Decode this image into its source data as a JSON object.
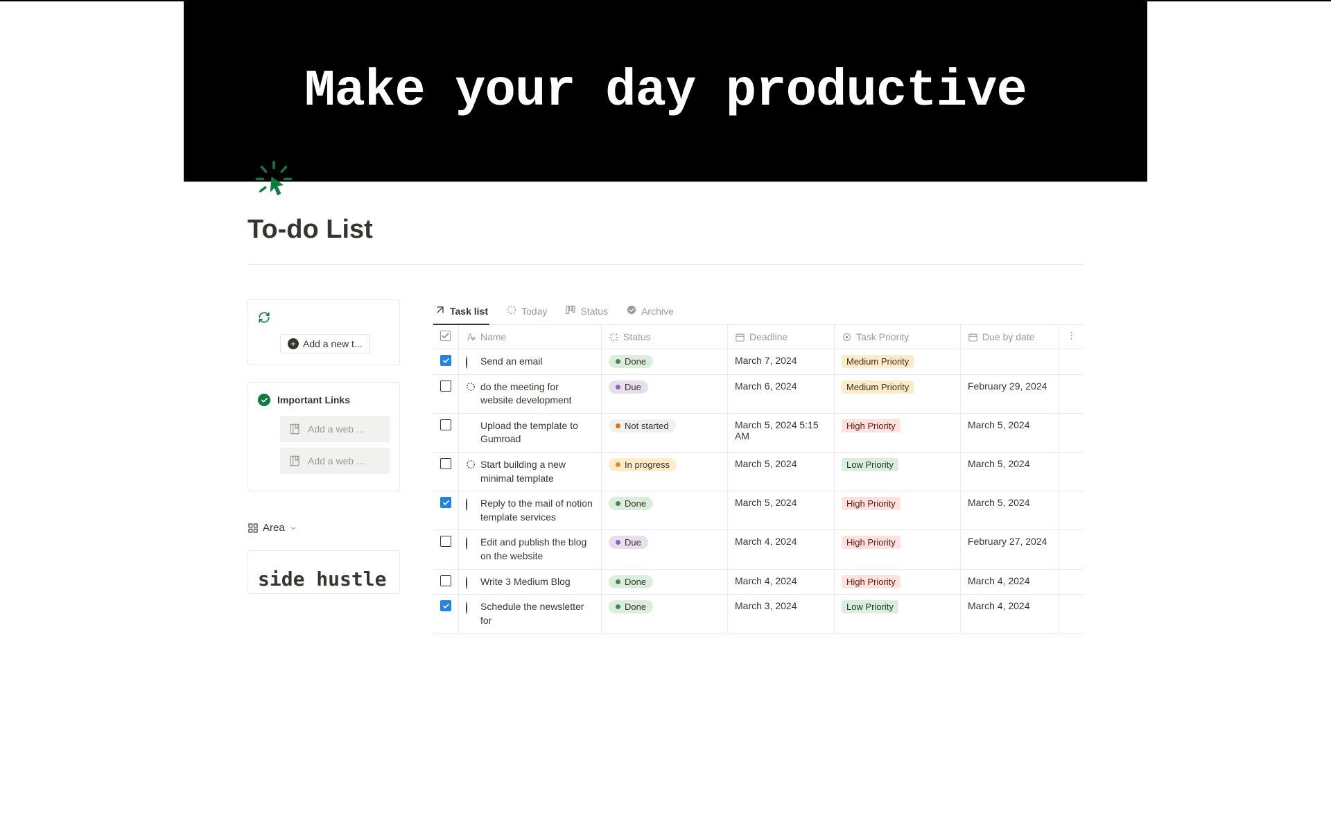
{
  "hero": {
    "title": "Make your day productive"
  },
  "page": {
    "title": "To-do List"
  },
  "sidebar": {
    "add_task_label": "Add a new t...",
    "links_title": "Important Links",
    "bookmark_placeholder": "Add a web ...",
    "area_label": "Area",
    "side_hustle": "side hustle"
  },
  "tabs": [
    {
      "id": "task-list",
      "label": "Task list",
      "icon": "arrow-up-right",
      "active": true
    },
    {
      "id": "today",
      "label": "Today",
      "icon": "dashed-circle",
      "active": false
    },
    {
      "id": "status",
      "label": "Status",
      "icon": "board",
      "active": false
    },
    {
      "id": "archive",
      "label": "Archive",
      "icon": "check-circle-solid",
      "active": false
    }
  ],
  "columns": {
    "name": "Name",
    "status": "Status",
    "deadline": "Deadline",
    "priority": "Task Priority",
    "due_by": "Due by date"
  },
  "status_colors": {
    "Done": "done",
    "Due": "due",
    "Not started": "notstarted",
    "In progress": "inprogress"
  },
  "priority_colors": {
    "Medium Priority": "medium",
    "High Priority": "high",
    "Low Priority": "low"
  },
  "rows": [
    {
      "checked": true,
      "ring": "solid",
      "name": "Send an email",
      "status": "Done",
      "deadline": "March 7, 2024",
      "priority": "Medium Priority",
      "due_by": ""
    },
    {
      "checked": false,
      "ring": "dashed",
      "name": "do the meeting for website development",
      "status": "Due",
      "deadline": "March 6, 2024",
      "priority": "Medium Priority",
      "due_by": "February 29, 2024"
    },
    {
      "checked": false,
      "ring": "none",
      "name": "Upload the template to Gumroad",
      "status": "Not started",
      "deadline": "March 5, 2024 5:15 AM",
      "priority": "High Priority",
      "due_by": "March 5, 2024"
    },
    {
      "checked": false,
      "ring": "dashed",
      "name": "Start building a new minimal template",
      "status": "In progress",
      "deadline": "March 5, 2024",
      "priority": "Low Priority",
      "due_by": "March 5, 2024"
    },
    {
      "checked": true,
      "ring": "solid",
      "name": "Reply to the mail of notion template services",
      "status": "Done",
      "deadline": "March 5, 2024",
      "priority": "High Priority",
      "due_by": "March 5, 2024"
    },
    {
      "checked": false,
      "ring": "solid",
      "name": "Edit and publish the blog on the website",
      "status": "Due",
      "deadline": "March 4, 2024",
      "priority": "High Priority",
      "due_by": "February 27, 2024"
    },
    {
      "checked": false,
      "ring": "solid",
      "name": "Write 3 Medium Blog",
      "status": "Done",
      "deadline": "March 4, 2024",
      "priority": "High Priority",
      "due_by": "March 4, 2024"
    },
    {
      "checked": true,
      "ring": "solid",
      "name": "Schedule the newsletter for",
      "status": "Done",
      "deadline": "March 3, 2024",
      "priority": "Low Priority",
      "due_by": "March 4, 2024"
    }
  ]
}
